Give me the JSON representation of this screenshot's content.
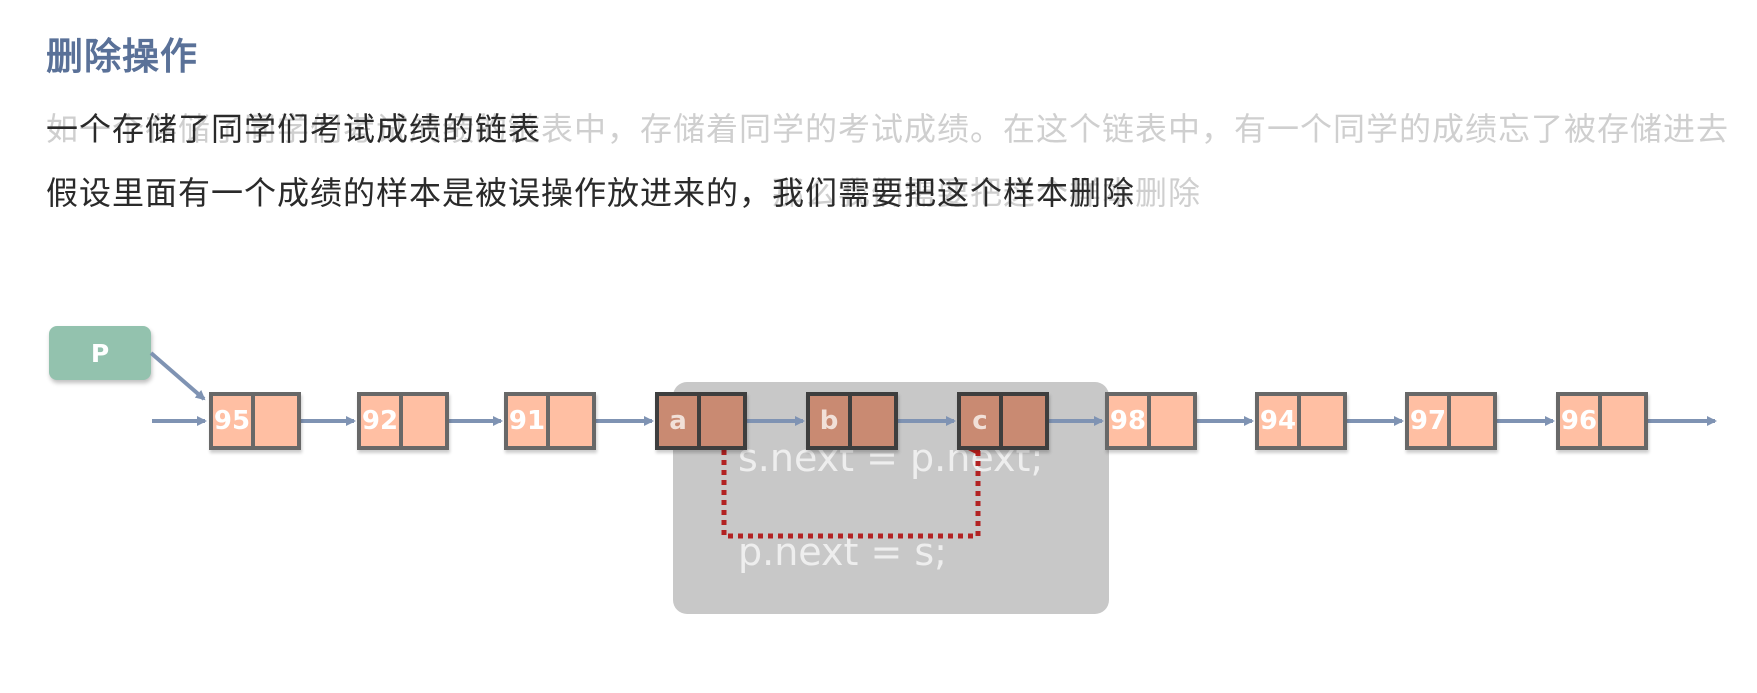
{
  "title": "删除操作",
  "text": {
    "line1_faded": "如一个存储了同学们考试成绩的链表中，存储着同学的考试成绩。在这个链表中，有一个同学的成绩忘了被存储进去",
    "line1": "一个存储了同学们考试成绩的链表",
    "line2_faded": "假设里面有一个成绩的样本是被误操作放进来的，那么我们需要把这个样本删除",
    "line2": "假设里面有一个成绩的样本是被误操作放进来的，我们需要把这个样本删除"
  },
  "pointer_label": "P",
  "code": {
    "line1": "s.next = p.next;",
    "line2": "p.next = s;"
  },
  "nodes": [
    {
      "label": "95",
      "highlighted": false
    },
    {
      "label": "92",
      "highlighted": false
    },
    {
      "label": "91",
      "highlighted": false
    },
    {
      "label": "a",
      "highlighted": true
    },
    {
      "label": "b",
      "highlighted": true
    },
    {
      "label": "c",
      "highlighted": true
    },
    {
      "label": "98",
      "highlighted": false
    },
    {
      "label": "94",
      "highlighted": false
    },
    {
      "label": "97",
      "highlighted": false
    },
    {
      "label": "96",
      "highlighted": false
    }
  ],
  "colors": {
    "title": "#5a7198",
    "node_fill": "#ffbfa3",
    "node_highlight_fill": "#c98a72",
    "arrow": "#7f93b3",
    "dotted_arrow": "#b22222",
    "pointer_box": "#93c2ae"
  }
}
